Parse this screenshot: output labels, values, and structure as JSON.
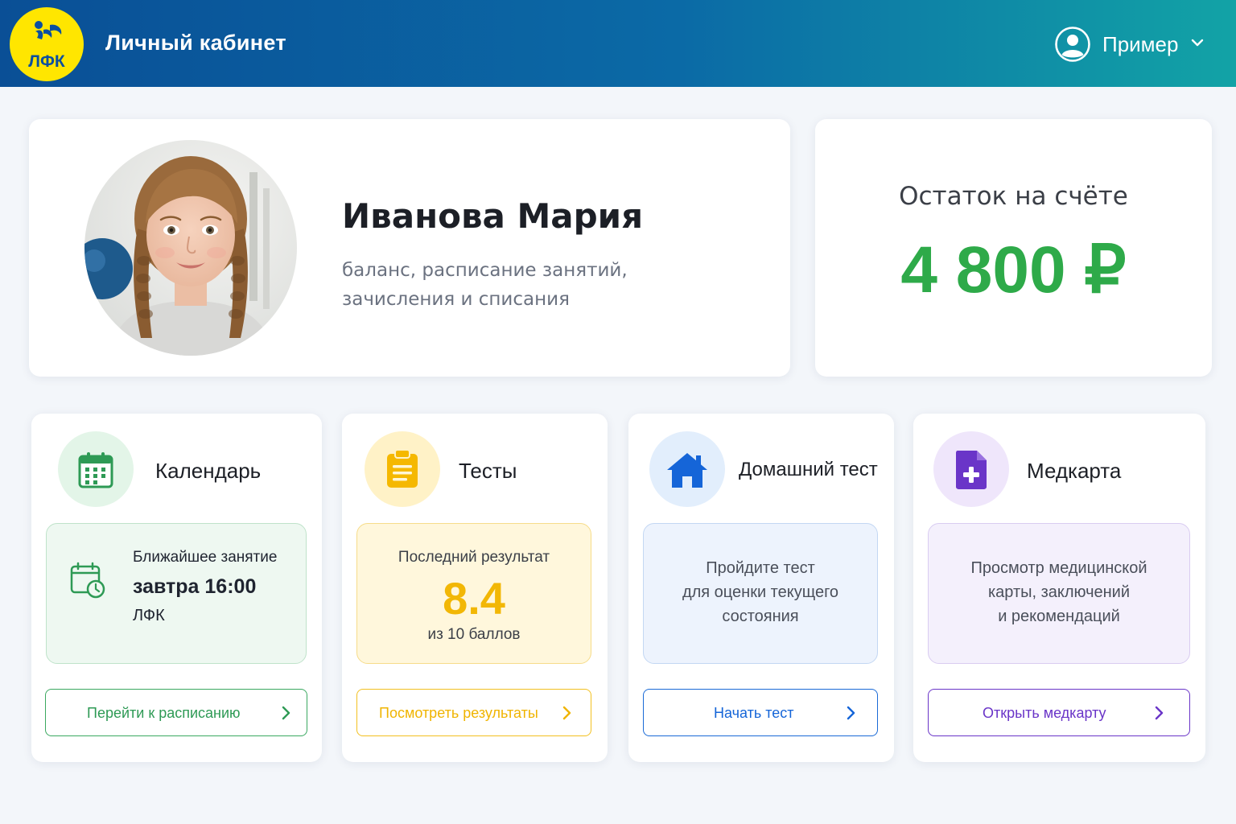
{
  "header": {
    "logo_text": "ЛФК",
    "title": "Личный кабинет",
    "user_name": "Пример"
  },
  "profile": {
    "name": "Иванова Мария",
    "description_line1": "баланс, расписание занятий,",
    "description_line2": "зачисления и списания"
  },
  "balance": {
    "label": "Остаток на счёте",
    "value": "4 800 ₽"
  },
  "tiles": {
    "calendar": {
      "title": "Календарь",
      "next_label": "Ближайшее занятие",
      "next_time": "завтра 16:00",
      "next_type": "ЛФК",
      "button": "Перейти к расписанию"
    },
    "tests": {
      "title": "Тесты",
      "last_label": "Последний результат",
      "score": "8.4",
      "score_suffix": "из 10 баллов",
      "button": "Посмотреть результаты"
    },
    "home_test": {
      "title": "Домашний тест",
      "line1": "Пройдите тест",
      "line2": "для оценки текущего",
      "line3": "состояния",
      "button": "Начать тест"
    },
    "medcard": {
      "title": "Медкарта",
      "line1": "Просмотр медицинской",
      "line2": "карты, заключений",
      "line3": "и рекомендаций",
      "button": "Открыть медкарту"
    }
  },
  "colors": {
    "header_start": "#0a4f96",
    "header_end": "#12a3a6",
    "logo_bg": "#ffe600",
    "balance_green": "#2eaa49",
    "calendar_green": "#2e9a55",
    "tests_yellow": "#f2b705",
    "home_blue": "#1565d8",
    "med_purple": "#6a35c8"
  },
  "icons": [
    "logo-mark-icon",
    "user-circle-icon",
    "chevron-down-icon",
    "calendar-icon",
    "clipboard-icon",
    "house-icon",
    "medical-document-icon",
    "calendar-clock-icon",
    "chevron-right-icon"
  ]
}
